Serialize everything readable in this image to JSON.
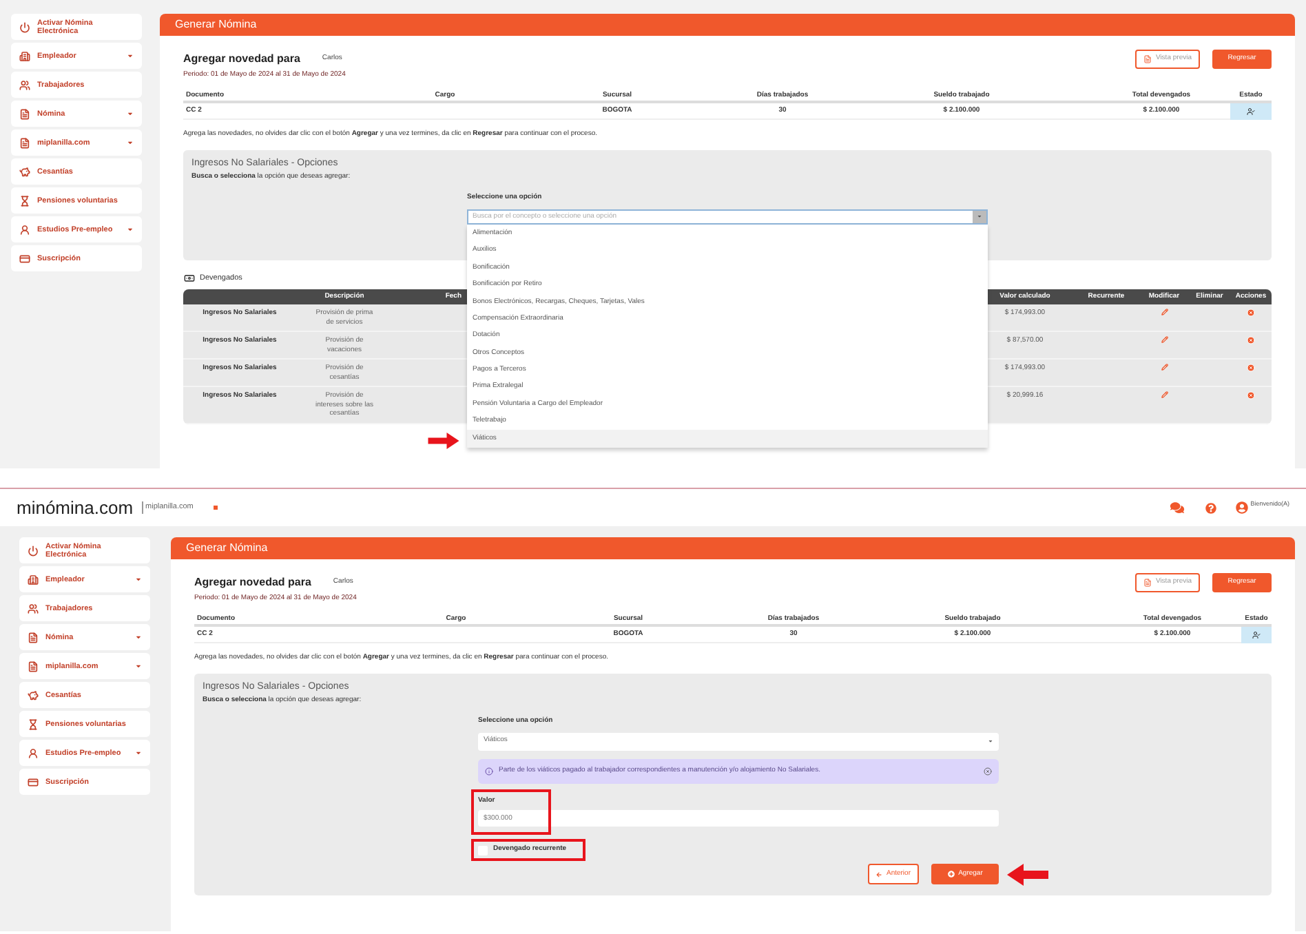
{
  "screens": [
    {
      "sidebar": [
        {
          "label": "Activar Nómina Electrónica",
          "kind": "power",
          "has_menu": false
        },
        {
          "label": "Empleador",
          "kind": "building",
          "has_menu": true
        },
        {
          "label": "Trabajadores",
          "kind": "people",
          "has_menu": false
        },
        {
          "label": "Nómina",
          "kind": "file",
          "has_menu": true
        },
        {
          "label": "miplanilla.com",
          "kind": "file",
          "has_menu": true
        },
        {
          "label": "Cesantías",
          "kind": "piggy",
          "has_menu": false
        },
        {
          "label": "Pensiones voluntarias",
          "kind": "hourglass",
          "has_menu": false
        },
        {
          "label": "Estudios Pre-empleo",
          "kind": "person",
          "has_menu": true
        },
        {
          "label": "Suscripción",
          "kind": "card",
          "has_menu": false
        }
      ],
      "page_title": "Generar Nómina",
      "heading": "Agregar novedad para",
      "employee": "Carlos",
      "preview_button": "Vista previa",
      "back_button": "Regresar",
      "period": "Periodo: 01 de Mayo de 2024 al 31 de Mayo de 2024",
      "employee_table": {
        "columns": [
          "Documento",
          "Cargo",
          "Sucursal",
          "Días trabajados",
          "Sueldo trabajado",
          "Total devengados",
          "Estado"
        ],
        "row": {
          "document": "CC 2",
          "branch": "BOGOTA",
          "days": "30",
          "salary": "$ 2.100.000",
          "total": "$ 2.100.000"
        }
      },
      "instructions": "Agrega las novedades, no olvides dar clic con el botón **Agregar** y una vez termines, da clic en **Regresar** para continuar con el proceso.",
      "section": {
        "title": "Ingresos No Salariales - Opciones",
        "hint": "**Busca o selecciona** la opción que deseas agregar:",
        "select_label": "Seleccione una opción",
        "select": {
          "placeholder": "Busca por el concepto o seleccione una opción",
          "expanded": true,
          "options": [
            {
              "label": "Alimentación",
              "selected": false
            },
            {
              "label": "Auxilios",
              "selected": false
            },
            {
              "label": "Bonificación",
              "selected": false
            },
            {
              "label": "Bonificación por Retiro",
              "selected": false
            },
            {
              "label": "Bonos Electrónicos, Recargas, Cheques, Tarjetas, Vales",
              "selected": false
            },
            {
              "label": "Compensación Extraordinaria",
              "selected": false
            },
            {
              "label": "Dotación",
              "selected": false
            },
            {
              "label": "Otros Conceptos",
              "selected": false
            },
            {
              "label": "Pagos a Terceros",
              "selected": false
            },
            {
              "label": "Prima Extralegal",
              "selected": false
            },
            {
              "label": "Pensión Voluntaria a Cargo del Empleador",
              "selected": false
            },
            {
              "label": "Teletrabajo",
              "selected": false
            },
            {
              "label": "Viáticos",
              "selected": true
            }
          ]
        }
      },
      "earnings": {
        "label": "Devengados",
        "columns": [
          "Descripción",
          "Fech",
          "Valor calculado",
          "Recurrente",
          "Modificar",
          "Eliminar",
          "Acciones"
        ],
        "rows": [
          {
            "concept": "Ingresos No Salariales",
            "description": "Provisión de prima de servicios",
            "value": "$ 174,993.00"
          },
          {
            "concept": "Ingresos No Salariales",
            "description": "Provisión de vacaciones",
            "value": "$ 87,570.00"
          },
          {
            "concept": "Ingresos No Salariales",
            "description": "Provisión de cesantías",
            "value": "$ 174,993.00"
          },
          {
            "concept": "Ingresos No Salariales",
            "description": "Provisión de intereses sobre las cesantías",
            "value": "$ 20,999.16"
          }
        ]
      }
    },
    {
      "header": {
        "logo": "minómina.com",
        "partner": "miplanilla.com",
        "welcome": "Bienvenido(A)"
      },
      "sidebar": [
        {
          "label": "Activar Nómina Electrónica",
          "kind": "power",
          "has_menu": false
        },
        {
          "label": "Empleador",
          "kind": "building",
          "has_menu": true
        },
        {
          "label": "Trabajadores",
          "kind": "people",
          "has_menu": false
        },
        {
          "label": "Nómina",
          "kind": "file",
          "has_menu": true
        },
        {
          "label": "miplanilla.com",
          "kind": "file",
          "has_menu": true
        },
        {
          "label": "Cesantías",
          "kind": "piggy",
          "has_menu": false
        },
        {
          "label": "Pensiones voluntarias",
          "kind": "hourglass",
          "has_menu": false
        },
        {
          "label": "Estudios Pre-empleo",
          "kind": "person",
          "has_menu": true
        },
        {
          "label": "Suscripción",
          "kind": "card",
          "has_menu": false
        }
      ],
      "page_title": "Generar Nómina",
      "heading": "Agregar novedad para",
      "employee": "Carlos",
      "preview_button": "Vista previa",
      "back_button": "Regresar",
      "period": "Periodo: 01 de Mayo de 2024 al 31 de Mayo de 2024",
      "employee_table": {
        "columns": [
          "Documento",
          "Cargo",
          "Sucursal",
          "Días trabajados",
          "Sueldo trabajado",
          "Total devengados",
          "Estado"
        ],
        "row": {
          "document": "CC 2",
          "branch": "BOGOTA",
          "days": "30",
          "salary": "$ 2.100.000",
          "total": "$ 2.100.000"
        }
      },
      "instructions": "Agrega las novedades, no olvides dar clic con el botón **Agregar** y una vez termines, da clic en **Regresar** para continuar con el proceso.",
      "section": {
        "title": "Ingresos No Salariales - Opciones",
        "hint": "**Busca o selecciona** la opción que deseas agregar:",
        "select_label": "Seleccione una opción",
        "select": {
          "value": "Viáticos",
          "expanded": false
        },
        "alert": "Parte de los viáticos pagado al trabajador correspondientes a manutención y/o alojamiento No Salariales.",
        "value_label": "Valor",
        "value": "$300.000",
        "recurring": {
          "label": "Devengado recurrente",
          "checked": false
        },
        "prev_button": "Anterior",
        "add_button": "Agregar"
      }
    }
  ]
}
